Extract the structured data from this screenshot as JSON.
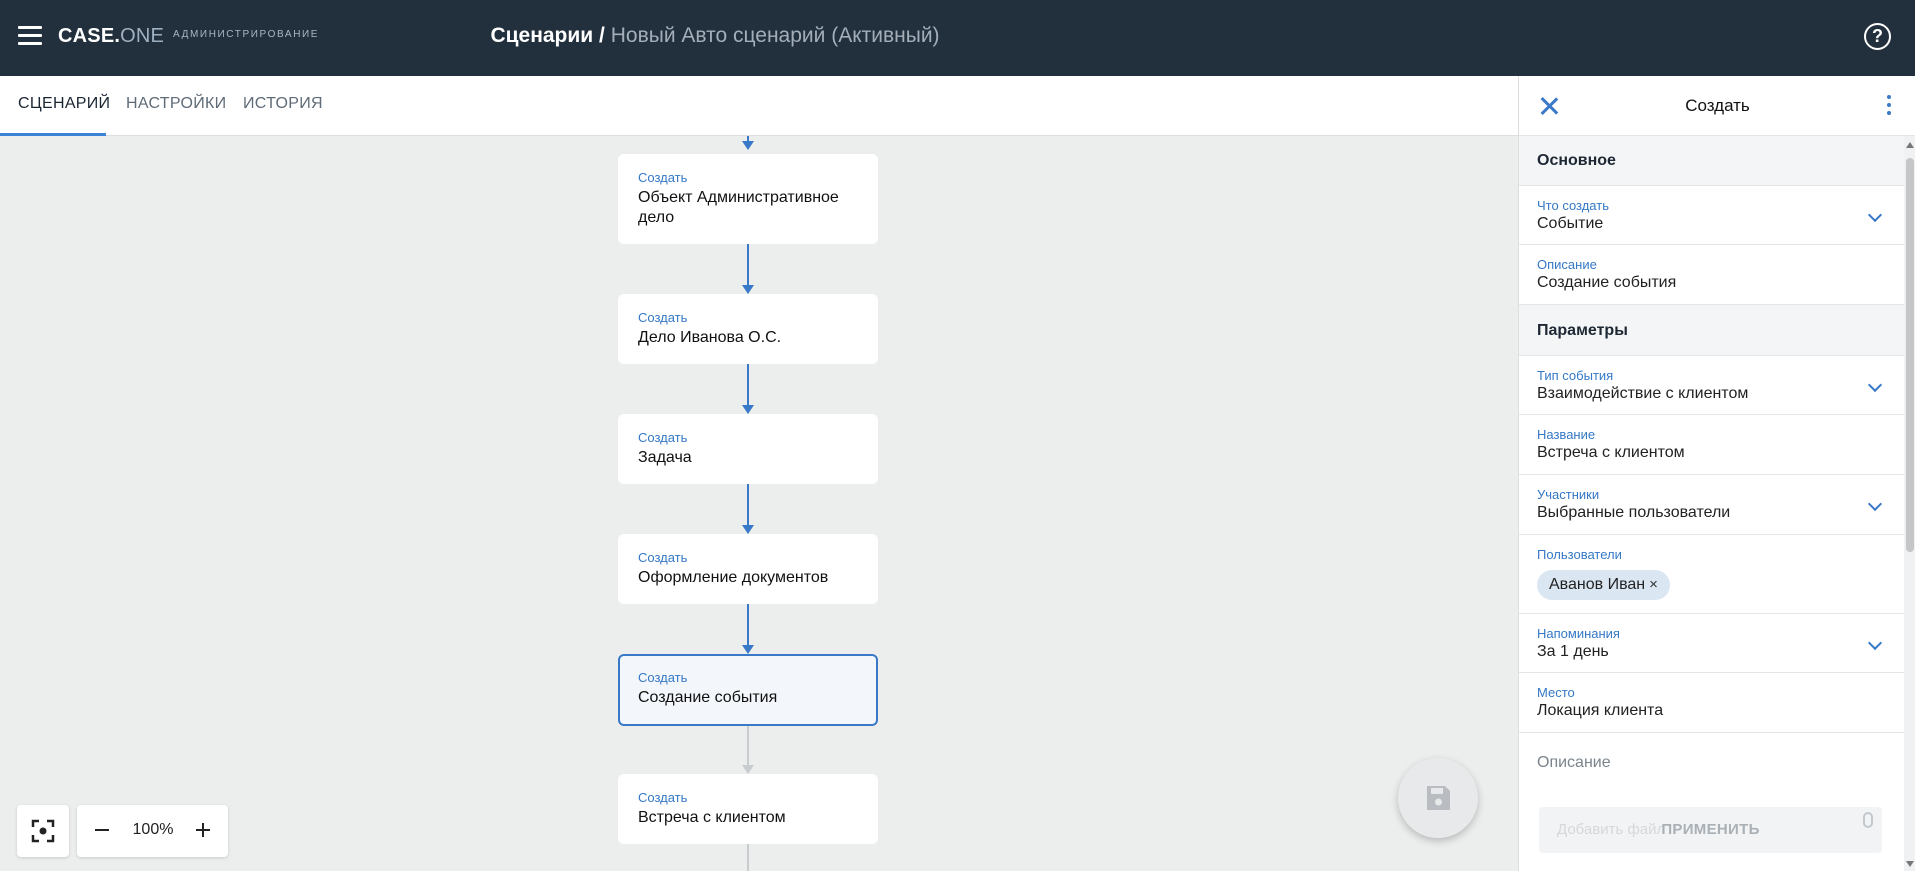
{
  "header": {
    "logo_main": "CASE.",
    "logo_accent": "ONE",
    "admin_label": "Администрирование",
    "title_main": "Сценарии",
    "title_separator": " / ",
    "title_sub": "Новый Авто сценарий (Активный)",
    "help_icon": "question-circle-icon"
  },
  "tabs": [
    {
      "label": "СЦЕНАРИЙ",
      "active": true
    },
    {
      "label": "НАСТРОЙКИ",
      "active": false
    },
    {
      "label": "ИСТОРИЯ",
      "active": false
    }
  ],
  "flow": {
    "nodes": [
      {
        "kind": "Создать",
        "name": "Объект Административное дело"
      },
      {
        "kind": "Создать",
        "name": "Дело Иванова О.С."
      },
      {
        "kind": "Создать",
        "name": "Задача"
      },
      {
        "kind": "Создать",
        "name": "Оформление документов"
      },
      {
        "kind": "Создать",
        "name": "Создание события",
        "selected": true
      },
      {
        "kind": "Создать",
        "name": "Встреча с клиентом"
      }
    ],
    "zoom": "100%"
  },
  "panel": {
    "title": "Создать",
    "sections": {
      "basic": "Основное",
      "params": "Параметры"
    },
    "fields": {
      "what_create": {
        "label": "Что создать",
        "value": "Событие"
      },
      "description": {
        "label": "Описание",
        "value": "Создание события"
      },
      "event_type": {
        "label": "Тип события",
        "value": "Взаимодействие с клиентом"
      },
      "name": {
        "label": "Название",
        "value": "Встреча с клиентом"
      },
      "participants": {
        "label": "Участники",
        "value": "Выбранные пользователи"
      },
      "users": {
        "label": "Пользователи",
        "chip": "Аванов Иван",
        "chip_remove": "×"
      },
      "reminders": {
        "label": "Напоминания",
        "value": "За 1 день"
      },
      "place": {
        "label": "Место",
        "value": "Локация клиента"
      },
      "event_description_placeholder": "Описание"
    },
    "attach_placeholder": "Добавить файл",
    "apply_label": "ПРИМЕНИТЬ"
  },
  "colors": {
    "header_bg": "#22303e",
    "accent": "#3a78c8",
    "canvas_bg": "#eceeed"
  }
}
